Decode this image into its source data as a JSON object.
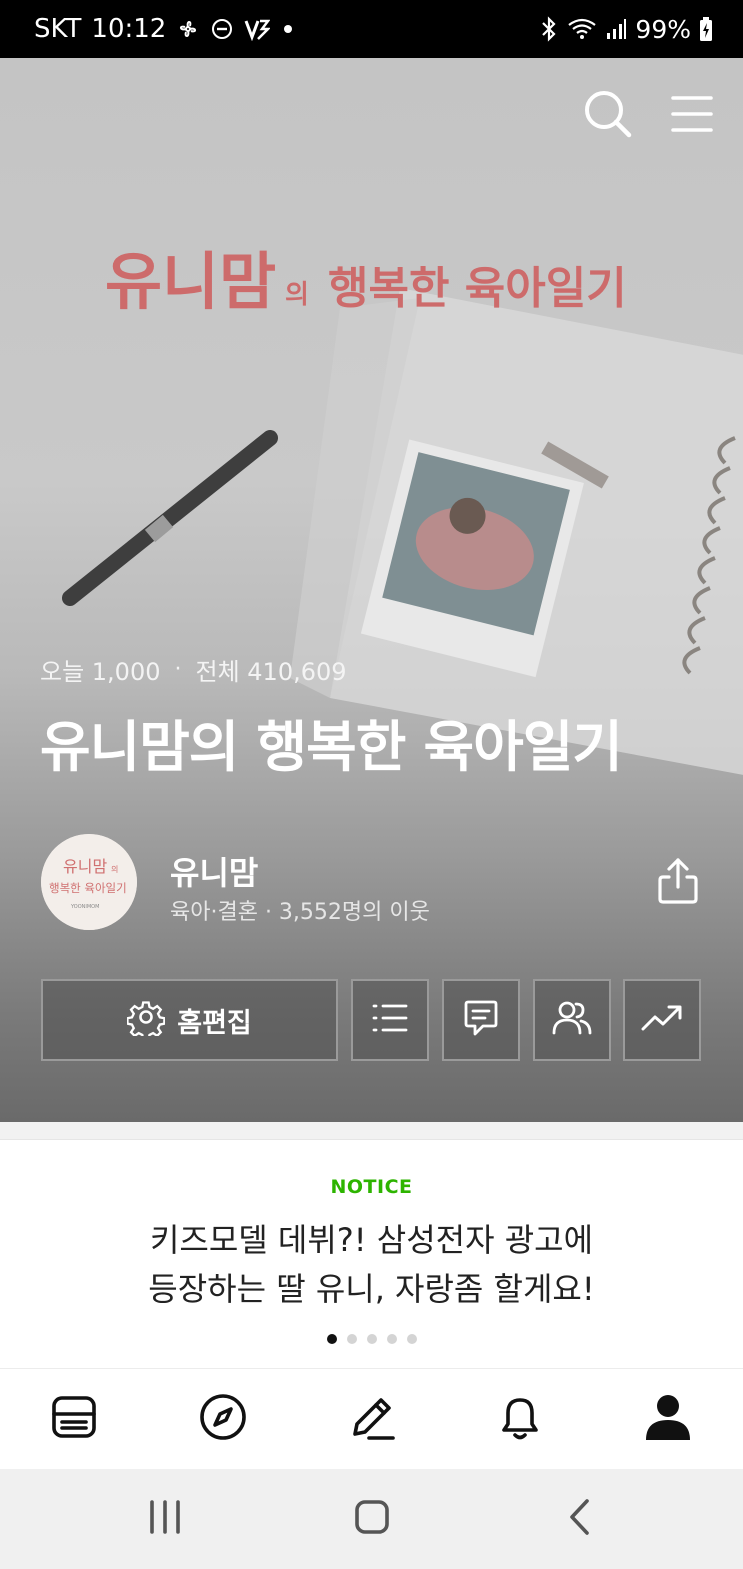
{
  "status_bar": {
    "carrier": "SKT",
    "time": "10:12",
    "battery": "99%"
  },
  "hero": {
    "banner_text_brand": "유니맘",
    "banner_text_particle": "의",
    "banner_text_rest": "행복한 육아일기",
    "stats": {
      "today_label": "오늘 1,000",
      "separator": "·",
      "total_label": "전체 410,609"
    },
    "title": "유니맘의 행복한 육아일기",
    "owner": {
      "name": "유니맘",
      "meta": "육아·결혼 · 3,552명의 이웃",
      "avatar_line1": "유니맘",
      "avatar_line1_suffix": "의",
      "avatar_line2": "행복한 육아일기",
      "avatar_line3": "YOONIMOM"
    },
    "actions": {
      "edit_label": "홈편집"
    }
  },
  "notice": {
    "label": "NOTICE",
    "line1": "키즈모델 데뷔?! 삼성전자 광고에",
    "line2": "등장하는 딸 유니, 자랑좀 할게요!",
    "page_count": 5,
    "active_page": 1
  },
  "icons": {
    "search": "search-icon",
    "menu": "hamburger-menu-icon",
    "share": "share-icon",
    "settings": "gear-icon",
    "list": "list-icon",
    "comment": "comment-icon",
    "neighbors": "people-icon",
    "stats": "trending-up-icon",
    "feed": "feed-icon",
    "explore": "compass-icon",
    "write": "pencil-icon",
    "notifications": "bell-icon",
    "profile": "person-icon"
  },
  "colors": {
    "notice_accent": "#2db400",
    "banner_pink": "#d46a6a"
  }
}
